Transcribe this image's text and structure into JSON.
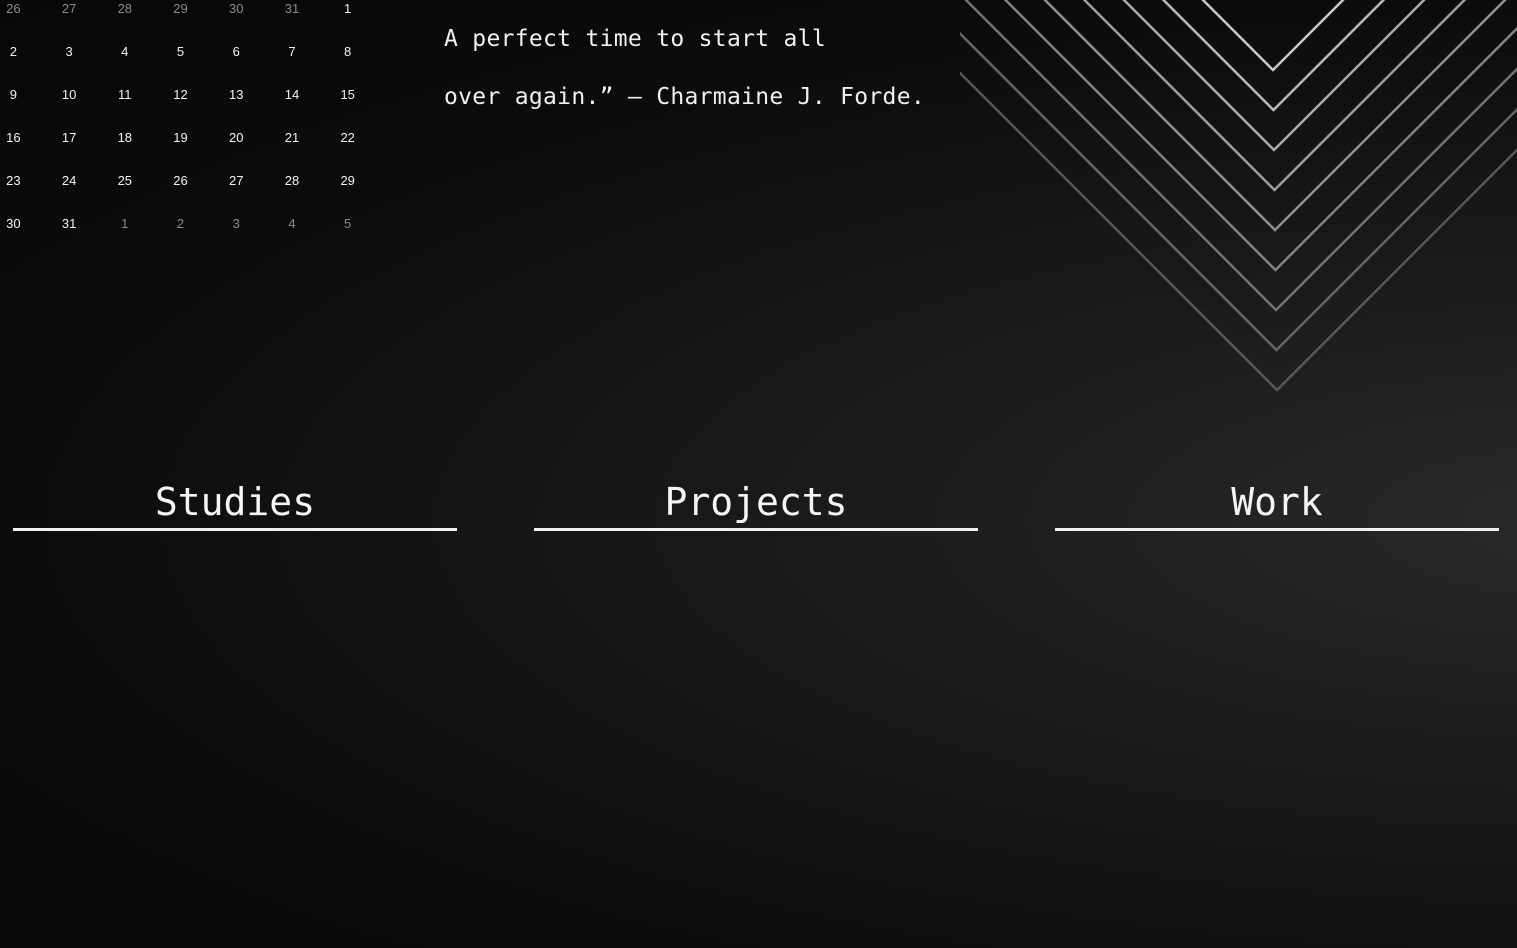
{
  "calendar": {
    "weeks": [
      [
        {
          "d": "26",
          "m": true
        },
        {
          "d": "27",
          "m": true
        },
        {
          "d": "28",
          "m": true
        },
        {
          "d": "29",
          "m": true
        },
        {
          "d": "30",
          "m": true
        },
        {
          "d": "31",
          "m": true
        },
        {
          "d": "1",
          "m": false
        }
      ],
      [
        {
          "d": "2",
          "m": false
        },
        {
          "d": "3",
          "m": false
        },
        {
          "d": "4",
          "m": false
        },
        {
          "d": "5",
          "m": false
        },
        {
          "d": "6",
          "m": false
        },
        {
          "d": "7",
          "m": false
        },
        {
          "d": "8",
          "m": false
        }
      ],
      [
        {
          "d": "9",
          "m": false
        },
        {
          "d": "10",
          "m": false
        },
        {
          "d": "11",
          "m": false
        },
        {
          "d": "12",
          "m": false
        },
        {
          "d": "13",
          "m": false
        },
        {
          "d": "14",
          "m": false
        },
        {
          "d": "15",
          "m": false
        }
      ],
      [
        {
          "d": "16",
          "m": false
        },
        {
          "d": "17",
          "m": false
        },
        {
          "d": "18",
          "m": false
        },
        {
          "d": "19",
          "m": false
        },
        {
          "d": "20",
          "m": false
        },
        {
          "d": "21",
          "m": false
        },
        {
          "d": "22",
          "m": false
        }
      ],
      [
        {
          "d": "23",
          "m": false
        },
        {
          "d": "24",
          "m": false
        },
        {
          "d": "25",
          "m": false
        },
        {
          "d": "26",
          "m": false
        },
        {
          "d": "27",
          "m": false
        },
        {
          "d": "28",
          "m": false
        },
        {
          "d": "29",
          "m": false
        }
      ],
      [
        {
          "d": "30",
          "m": false
        },
        {
          "d": "31",
          "m": false
        },
        {
          "d": "1",
          "m": true
        },
        {
          "d": "2",
          "m": true
        },
        {
          "d": "3",
          "m": true
        },
        {
          "d": "4",
          "m": true
        },
        {
          "d": "5",
          "m": true
        }
      ]
    ]
  },
  "quote": {
    "line1": "A perfect time to start all",
    "line2": "over again.” – Charmaine J. Forde."
  },
  "sections": {
    "studies": "Studies",
    "projects": "Projects",
    "work": "Work"
  },
  "colors": {
    "background": "#0c0c0c",
    "text": "#f2f2f2",
    "muted": "#8a8a8a"
  }
}
